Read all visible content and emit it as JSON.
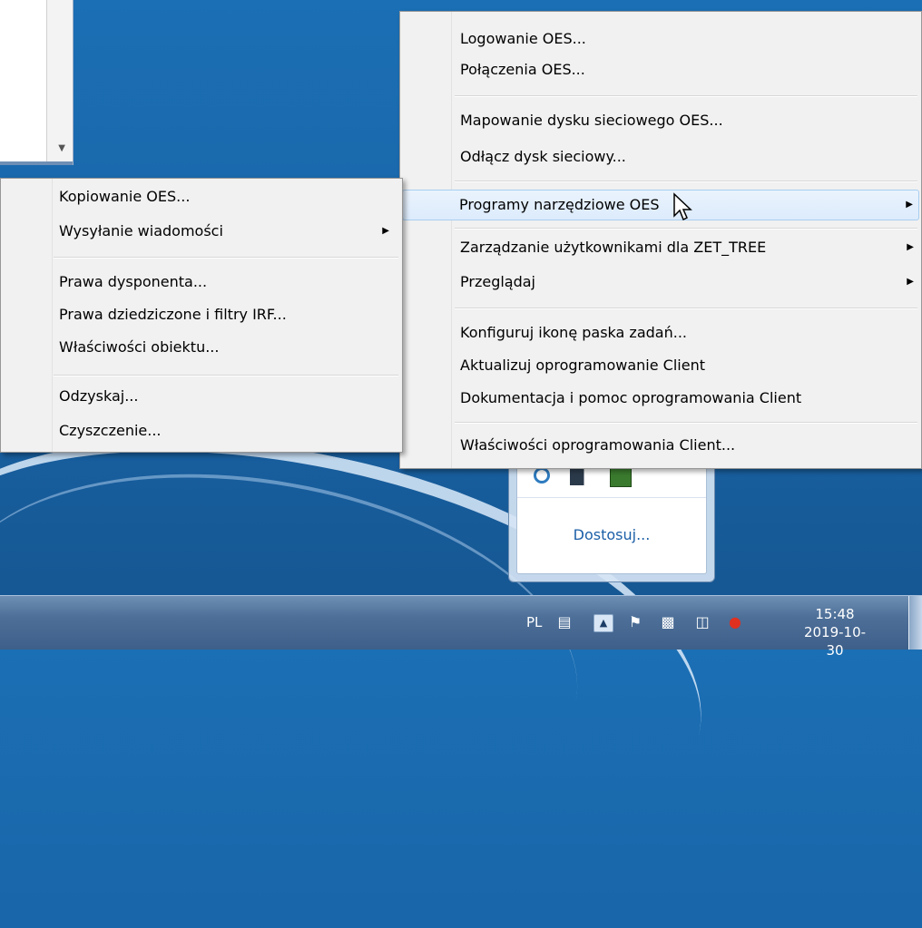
{
  "main_menu": {
    "items": [
      {
        "label": "Logowanie OES..."
      },
      {
        "label": "Połączenia OES..."
      },
      {
        "label": "Mapowanie dysku sieciowego OES..."
      },
      {
        "label": "Odłącz dysk sieciowy..."
      },
      {
        "label": "Programy narzędziowe OES",
        "submenu": true,
        "highlighted": true
      },
      {
        "label": "Zarządzanie użytkownikami dla ZET_TREE",
        "submenu": true
      },
      {
        "label": "Przeglądaj",
        "submenu": true
      },
      {
        "label": "Konfiguruj ikonę paska zadań..."
      },
      {
        "label": "Aktualizuj oprogramowanie Client"
      },
      {
        "label": "Dokumentacja i pomoc oprogramowania Client"
      },
      {
        "label": "Właściwości oprogramowania Client..."
      }
    ]
  },
  "sub_menu": {
    "items": [
      {
        "label": "Kopiowanie OES..."
      },
      {
        "label": "Wysyłanie wiadomości",
        "submenu": true
      },
      {
        "label": "Prawa dysponenta..."
      },
      {
        "label": "Prawa dziedziczone i filtry IRF..."
      },
      {
        "label": "Właściwości obiektu..."
      },
      {
        "label": "Odzyskaj..."
      },
      {
        "label": "Czyszczenie..."
      }
    ]
  },
  "tray_popup": {
    "customize_label": "Dostosuj..."
  },
  "taskbar": {
    "language": "PL",
    "time": "15:48",
    "date": "2019-10-30"
  },
  "icons": {
    "submenu_arrow": "chevron-right-icon",
    "tray": [
      "printer-icon",
      "show-hidden-icons",
      "flag-icon",
      "device-icon",
      "network-icon",
      "volume-muted-icon"
    ]
  },
  "colors": {
    "desktop": "#1b6fb4",
    "menu_bg": "#f1f1f1",
    "highlight": "#dcebfc",
    "link": "#1c5fa8"
  }
}
